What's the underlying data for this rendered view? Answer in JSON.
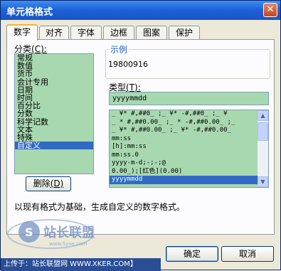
{
  "window": {
    "title": "单元格格式",
    "close_glyph": "✕"
  },
  "tabs": [
    "数字",
    "对齐",
    "字体",
    "边框",
    "图案",
    "保护"
  ],
  "category": {
    "label": "分类",
    "label_key": "(C):",
    "items": [
      "常规",
      "数值",
      "货币",
      "会计专用",
      "日期",
      "时间",
      "百分比",
      "分数",
      "科学记数",
      "文本",
      "特殊",
      "自定义"
    ],
    "selected": "自定义"
  },
  "sample": {
    "label": "示例",
    "value": "19800916"
  },
  "type": {
    "label": "类型",
    "label_key": "(T):",
    "value": "yyyymmdd"
  },
  "formats": [
    "_ ¥* #,##0_ ;_ ¥* -#,##0_ ;_ ¥",
    "_ * #,##0.00_ ;_ * -#,##0.00_ ;_",
    "_ ¥* #,##0.00_ ;_ ¥* -#,##0.00_",
    "mm:ss",
    "[h]:mm:ss",
    "mm:ss.0",
    "yyyy-m-d;-;-;@",
    "0.00_);[红色](0.00)",
    "yyyymmdd"
  ],
  "formats_selected": "yyyymmdd",
  "delete_button": "删除",
  "delete_key": "(D)",
  "description": "以现有格式为基础，生成自定义的数字格式。",
  "buttons": {
    "ok": "确定",
    "cancel": "取消"
  },
  "watermark": {
    "text": "上传于：站长联盟网 WWW.XKER.COM】",
    "logo_text": "站长联盟",
    "logo_letter": "S",
    "logo_url": "www.Syue.com"
  }
}
